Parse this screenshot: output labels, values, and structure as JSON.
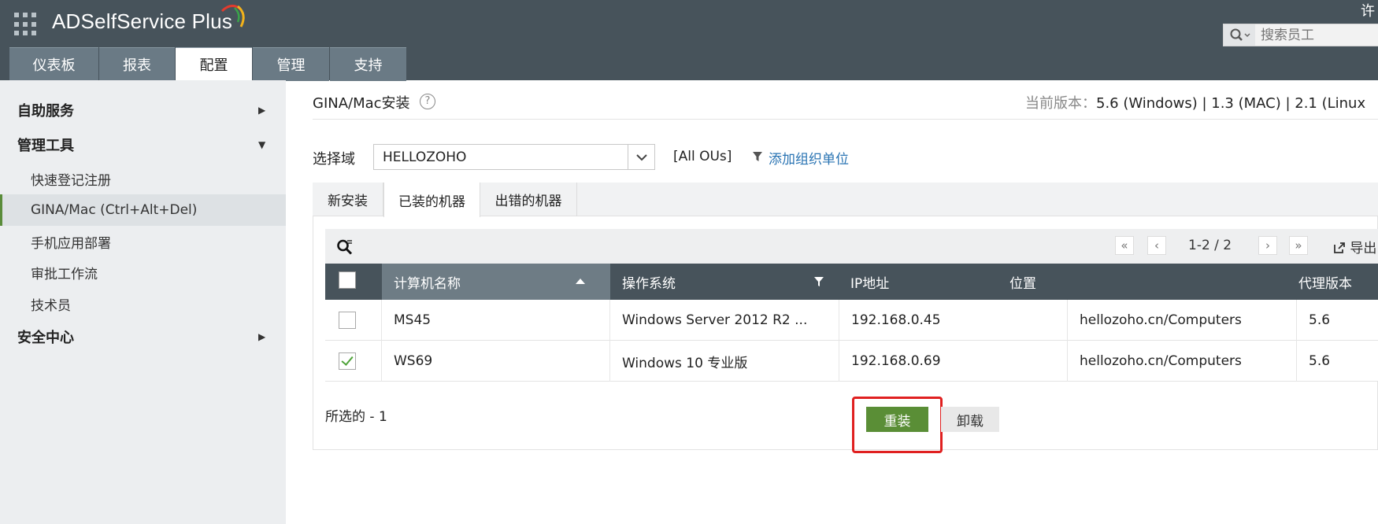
{
  "header": {
    "app_name": "ADSelfService Plus",
    "user_initial": "许",
    "search_placeholder": "搜索员工",
    "tabs": [
      {
        "label": "仪表板",
        "active": false
      },
      {
        "label": "报表",
        "active": false
      },
      {
        "label": "配置",
        "active": true
      },
      {
        "label": "管理",
        "active": false
      },
      {
        "label": "支持",
        "active": false
      }
    ]
  },
  "sidebar": {
    "sections": [
      {
        "label": "自助服务",
        "expanded": false
      },
      {
        "label": "管理工具",
        "expanded": true
      },
      {
        "label": "安全中心",
        "expanded": false
      }
    ],
    "items": [
      {
        "label": "快速登记注册",
        "active": false
      },
      {
        "label": "GINA/Mac (Ctrl+Alt+Del)",
        "active": true
      },
      {
        "label": "手机应用部署",
        "active": false
      },
      {
        "label": "审批工作流",
        "active": false
      },
      {
        "label": "技术员",
        "active": false
      }
    ]
  },
  "main": {
    "title": "GINA/Mac安装",
    "version_label": "当前版本：",
    "version_value": "5.6 (Windows) | 1.3 (MAC) | 2.1 (Linux",
    "domain_label": "选择域",
    "domain_value": "HELLOZOHO",
    "ou_scope": "[All OUs]",
    "add_ou_label": "添加组织单位",
    "subtabs": [
      {
        "label": "新安装",
        "active": false
      },
      {
        "label": "已装的机器",
        "active": true
      },
      {
        "label": "出错的机器",
        "active": false
      }
    ],
    "pagination": "1-2 / 2",
    "export_label": "导出"
  },
  "grid": {
    "columns": [
      "计算机名称",
      "操作系统",
      "IP地址",
      "位置",
      "代理版本"
    ],
    "rows": [
      {
        "checked": false,
        "name": "MS45",
        "os": "Windows Server 2012 R2 ...",
        "ip": "192.168.0.45",
        "location": "hellozoho.cn/Computers",
        "agent": "5.6"
      },
      {
        "checked": true,
        "name": "WS69",
        "os": "Windows 10 专业版",
        "ip": "192.168.0.69",
        "location": "hellozoho.cn/Computers",
        "agent": "5.6"
      }
    ]
  },
  "footer": {
    "selected_text": "所选的 - 1",
    "reinstall_label": "重装",
    "uninstall_label": "卸载"
  },
  "colors": {
    "header_bg": "#47535b",
    "tab_bg": "#6a7a85",
    "sidebar_bg": "#eceef0",
    "accent_green": "#5a8e36",
    "link_blue": "#2a74b3",
    "highlight_red": "#e02020"
  },
  "icons": [
    "app-grid-icon",
    "search-icon",
    "help-icon",
    "chevron-down-icon",
    "filter-icon",
    "search-filter-icon",
    "first-page-icon",
    "prev-page-icon",
    "next-page-icon",
    "last-page-icon",
    "export-icon",
    "sort-asc-icon",
    "checkmark-icon"
  ]
}
